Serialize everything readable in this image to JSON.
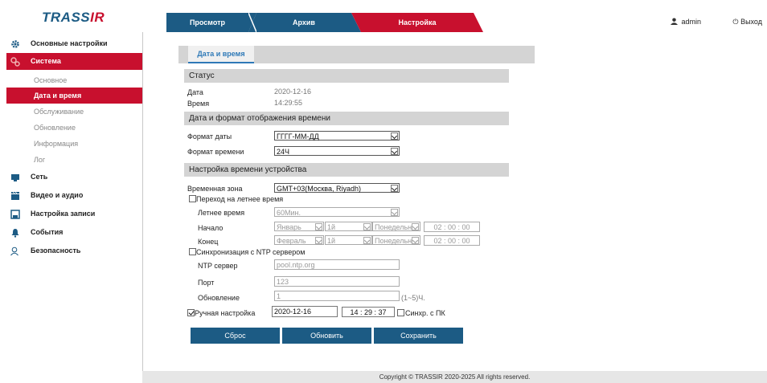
{
  "header": {
    "logo": "TRASSIR",
    "tabs": [
      "Просмотр",
      "Архив",
      "Настройка"
    ],
    "user": "admin",
    "logout": "Выход"
  },
  "sidebar": {
    "items": [
      {
        "label": "Основные настройки",
        "icon": "gear-icon"
      },
      {
        "label": "Система",
        "icon": "system-icon"
      },
      {
        "label": "Сеть",
        "icon": "network-icon"
      },
      {
        "label": "Видео и аудио",
        "icon": "clapper-icon"
      },
      {
        "label": "Настройка записи",
        "icon": "save-icon"
      },
      {
        "label": "События",
        "icon": "bell-icon"
      },
      {
        "label": "Безопасность",
        "icon": "user-icon"
      }
    ],
    "subitems": [
      "Основное",
      "Дата и время",
      "Обслуживание",
      "Обновление",
      "Информация",
      "Лог"
    ]
  },
  "page": {
    "tab": "Дата и время",
    "status_title": "Статус",
    "date_label": "Дата",
    "date_value": "2020-12-16",
    "time_label": "Время",
    "time_value": "14:29:55",
    "format_title": "Дата и формат отображения времени",
    "date_format_label": "Формат даты",
    "date_format_value": "ГГГГ-ММ-ДД",
    "time_format_label": "Формат времени",
    "time_format_value": "24Ч",
    "device_title": "Настройка времени устройства",
    "timezone_label": "Временная зона",
    "timezone_value": "GMT+03(Москва, Riyadh)",
    "dst_label": "Переход на летнее время",
    "summer_label": "Летнее время",
    "summer_value": "60Мин.",
    "start_label": "Начало",
    "start_month": "Январь",
    "start_week": "1й",
    "start_day": "Понедельн",
    "start_time": "02 : 00 : 00",
    "end_label": "Конец",
    "end_month": "Февраль",
    "end_week": "1й",
    "end_day": "Понедельн",
    "end_time": "02 : 00 : 00",
    "ntp_label": "Синхронизация с NTP сервером",
    "ntp_server_label": "NTP сервер",
    "ntp_server_value": "pool.ntp.org",
    "port_label": "Порт",
    "port_value": "123",
    "update_label": "Обновление",
    "update_value": "1",
    "update_hint": "(1~5)Ч.",
    "manual_label": "Ручная настройка",
    "manual_date": "2020-12-16",
    "manual_time": "14 : 29 : 37",
    "sync_pc_label": "Синхр. с ПК",
    "buttons": {
      "reset": "Сброс",
      "refresh": "Обновить",
      "save": "Сохранить"
    }
  },
  "footer": "Copyright © TRASSIR 2020-2025 All rights reserved.",
  "colors": {
    "brand_blue": "#1c5b84",
    "brand_red": "#c8102e",
    "section_gray": "#d4d4d4"
  }
}
